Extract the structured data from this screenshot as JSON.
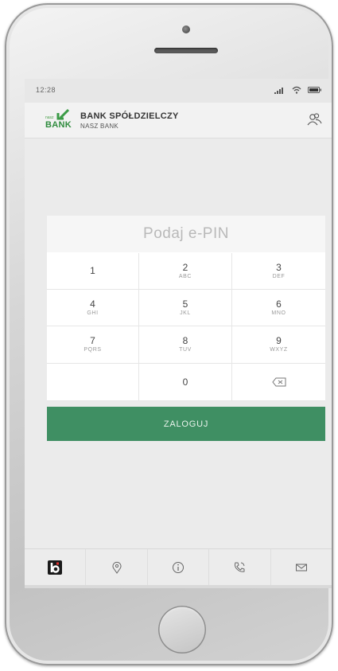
{
  "status_bar": {
    "time": "12:28"
  },
  "header": {
    "logo_small_text": "nasz",
    "logo_text": "BANK",
    "bank_name": "BANK SPÓŁDZIELCZY",
    "bank_subtitle": "NASZ BANK"
  },
  "pin": {
    "prompt": "Podaj e-PIN",
    "keys": [
      {
        "digit": "1",
        "letters": ""
      },
      {
        "digit": "2",
        "letters": "ABC"
      },
      {
        "digit": "3",
        "letters": "DEF"
      },
      {
        "digit": "4",
        "letters": "GHI"
      },
      {
        "digit": "5",
        "letters": "JKL"
      },
      {
        "digit": "6",
        "letters": "MNO"
      },
      {
        "digit": "7",
        "letters": "PQRS"
      },
      {
        "digit": "8",
        "letters": "TUV"
      },
      {
        "digit": "9",
        "letters": "WXYZ"
      },
      {
        "digit": "0",
        "letters": ""
      }
    ]
  },
  "actions": {
    "login_label": "ZALOGUJ"
  },
  "bottom_nav": {
    "items": [
      "brand-logo",
      "location-icon",
      "info-icon",
      "phone-icon",
      "mail-icon"
    ]
  },
  "colors": {
    "accent": "#3f8f63",
    "brand_green": "#2e8b3d",
    "background": "#ebebeb"
  }
}
